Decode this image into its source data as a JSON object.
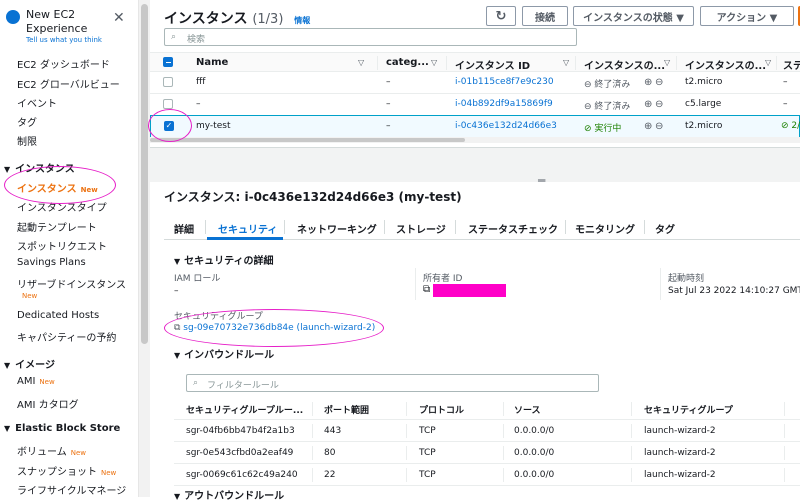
{
  "sidebar": {
    "title": "New EC2 Experience",
    "subtitle": "Tell us what you think",
    "close": "✕",
    "items_top": [
      "EC2 ダッシュボード",
      "EC2 グローバルビュー",
      "イベント",
      "タグ",
      "制限"
    ],
    "section_instances": "インスタンス",
    "instances_items": [
      "インスタンス",
      "インスタンスタイプ",
      "起動テンプレート",
      "スポットリクエスト",
      "Savings Plans",
      "リザーブドインスタンス",
      "Dedicated Hosts",
      "キャパシティーの予約"
    ],
    "new_badge": "New",
    "section_images": "イメージ",
    "images_items": [
      "AMI",
      "AMI カタログ"
    ],
    "section_ebs": "Elastic Block Store",
    "ebs_items": [
      "ボリューム",
      "スナップショット",
      "ライフサイクルマネージ"
    ]
  },
  "toolbar": {
    "title": "インスタンス",
    "count": "(1/3)",
    "info": "情報",
    "refresh": "↻",
    "connect": "接続",
    "state": "インスタンスの状態 ▼",
    "actions": "アクション ▼"
  },
  "search": {
    "placeholder": "検索"
  },
  "table": {
    "columns": [
      "Name",
      "categ...",
      "インスタンス ID",
      "インスタンスの...",
      "インスタンスの...",
      "ステ"
    ],
    "rows": [
      {
        "name": "fff",
        "categ": "–",
        "id": "i-01b115ce8f7e9c230",
        "state": "終了済み",
        "type": "t2.micro",
        "status": "–",
        "selected": false
      },
      {
        "name": "–",
        "categ": "–",
        "id": "i-04b892df9a15869f9",
        "state": "終了済み",
        "type": "c5.large",
        "status": "–",
        "selected": false
      },
      {
        "name": "my-test",
        "categ": "–",
        "id": "i-0c436e132d24d66e3",
        "state": "実行中",
        "type": "t2.micro",
        "status": "2/",
        "selected": true
      }
    ]
  },
  "detail": {
    "title": "インスタンス: i-0c436e132d24d66e3 (my-test)",
    "tabs": [
      "詳細",
      "セキュリティ",
      "ネットワーキング",
      "ストレージ",
      "ステータスチェック",
      "モニタリング",
      "タグ"
    ],
    "sec_title": "セキュリティの詳細",
    "iam_label": "IAM ロール",
    "iam_value": "–",
    "owner_label": "所有者 ID",
    "launch_label": "起動時刻",
    "launch_value": "Sat Jul 23 2022 14:10:27 GMT+0",
    "sg_label": "セキュリティグループ",
    "sg_value": "sg-09e70732e736db84e (launch-wizard-2)",
    "inbound_title": "インバウンドルール",
    "filter_placeholder": "フィルタールール",
    "rule_columns": [
      "セキュリティグループルー...",
      "ポート範囲",
      "プロトコル",
      "ソース",
      "セキュリティグループ"
    ],
    "rules": [
      {
        "id": "sgr-04fb6bb47b4f2a1b3",
        "port": "443",
        "proto": "TCP",
        "source": "0.0.0.0/0",
        "sg": "launch-wizard-2"
      },
      {
        "id": "sgr-0e543cfbd0a2eaf49",
        "port": "80",
        "proto": "TCP",
        "source": "0.0.0.0/0",
        "sg": "launch-wizard-2"
      },
      {
        "id": "sgr-0069c61c62c49a240",
        "port": "22",
        "proto": "TCP",
        "source": "0.0.0.0/0",
        "sg": "launch-wizard-2"
      }
    ],
    "outbound_title": "アウトバウンドルール"
  },
  "colors": {
    "accent": "#0972d3",
    "orange": "#ec7211",
    "running": "#1d8102",
    "annotation": "#e61ec8",
    "redact": "#ff00c8"
  }
}
